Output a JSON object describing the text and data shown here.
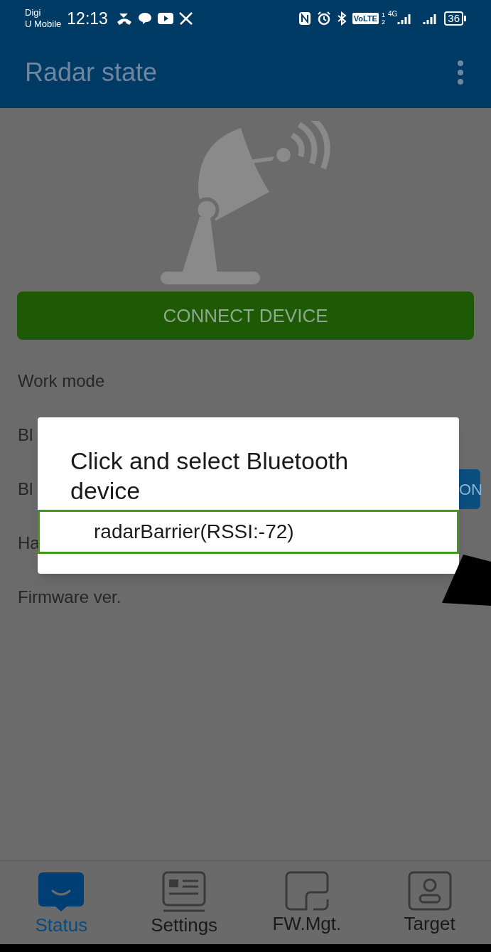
{
  "status_bar": {
    "carrier_lines": [
      "Digi",
      "U Mobile"
    ],
    "time": "12:13",
    "volte": "VoLTE",
    "sim_slots": [
      "1",
      "2"
    ],
    "network": "4G",
    "battery": "36"
  },
  "app_bar": {
    "title": "Radar state"
  },
  "connect_button": {
    "label": "CONNECT DEVICE"
  },
  "rows": [
    {
      "label": "Work mode"
    },
    {
      "label": "Bl"
    },
    {
      "label": "Bl",
      "button": "ON"
    },
    {
      "label": "Ha"
    },
    {
      "label": "Firmware ver."
    }
  ],
  "dialog": {
    "title": "Click and select Bluetooth device",
    "devices": [
      {
        "name": "radarBarrier(RSSI:-72)",
        "selected": true
      }
    ]
  },
  "bottom_nav": [
    {
      "kind": "status",
      "label": "Status",
      "selected": true
    },
    {
      "kind": "settings",
      "label": "Settings",
      "selected": false
    },
    {
      "kind": "firmware",
      "label": "FW.Mgt.",
      "selected": false
    },
    {
      "kind": "target",
      "label": "Target",
      "selected": false
    }
  ]
}
